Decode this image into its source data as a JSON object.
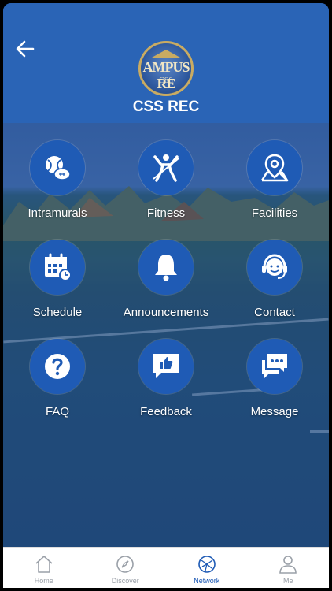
{
  "header": {
    "title": "CSS REC",
    "logo_text": "AMPUS RE",
    "logo_subtext": "CSS"
  },
  "grid": [
    {
      "label": "Intramurals",
      "icon": "sports-balls-icon"
    },
    {
      "label": "Fitness",
      "icon": "fitness-person-icon"
    },
    {
      "label": "Facilities",
      "icon": "map-pin-icon"
    },
    {
      "label": "Schedule",
      "icon": "calendar-clock-icon"
    },
    {
      "label": "Announcements",
      "icon": "bell-icon"
    },
    {
      "label": "Contact",
      "icon": "headset-icon"
    },
    {
      "label": "FAQ",
      "icon": "question-icon"
    },
    {
      "label": "Feedback",
      "icon": "thumbs-up-icon"
    },
    {
      "label": "Message",
      "icon": "chat-icon"
    }
  ],
  "tabs": [
    {
      "label": "Home",
      "icon": "home-icon",
      "active": false
    },
    {
      "label": "Discover",
      "icon": "compass-icon",
      "active": false
    },
    {
      "label": "Network",
      "icon": "network-icon",
      "active": true
    },
    {
      "label": "Me",
      "icon": "person-icon",
      "active": false
    }
  ],
  "colors": {
    "header": "#2a64b6",
    "circle": "#1f5bb5",
    "active_tab": "#1f5bb5",
    "inactive_tab": "#9aa0a8"
  }
}
